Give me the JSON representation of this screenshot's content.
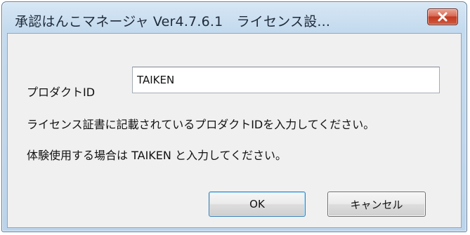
{
  "window": {
    "title": "承認はんこマネージャ Ver4.7.6.1　ライセンス設...",
    "close_icon": "close-icon",
    "close_color": "#c23a22"
  },
  "form": {
    "product_label": "プロダクトID",
    "product_value": "TAIKEN"
  },
  "info": {
    "line1": "ライセンス証書に記載されているプロダクトIDを入力してください。",
    "line2": "体験使用する場合は TAIKEN と入力してください。"
  },
  "buttons": {
    "ok": "OK",
    "cancel": "キャンセル"
  }
}
